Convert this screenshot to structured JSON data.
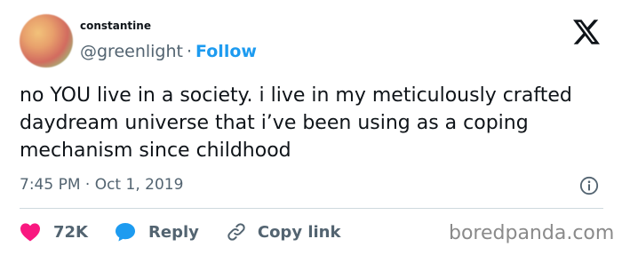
{
  "author": {
    "display_name": "constantine",
    "handle": "@greenlight",
    "separator": "·",
    "follow_label": "Follow"
  },
  "tweet": {
    "text": "no YOU live in a society. i live in my meticulously crafted daydream universe that i’ve been using as a coping mechanism since childhood",
    "timestamp": "7:45 PM · Oct 1, 2019"
  },
  "actions": {
    "like_count": "72K",
    "reply_label": "Reply",
    "copy_label": "Copy link"
  },
  "watermark": "boredpanda.com",
  "colors": {
    "like": "#f91880",
    "link": "#1d9bf0",
    "secondary_text": "#536471"
  },
  "icons": [
    "x-logo-icon",
    "info-icon",
    "heart-icon",
    "reply-bubble-icon",
    "link-chain-icon"
  ]
}
